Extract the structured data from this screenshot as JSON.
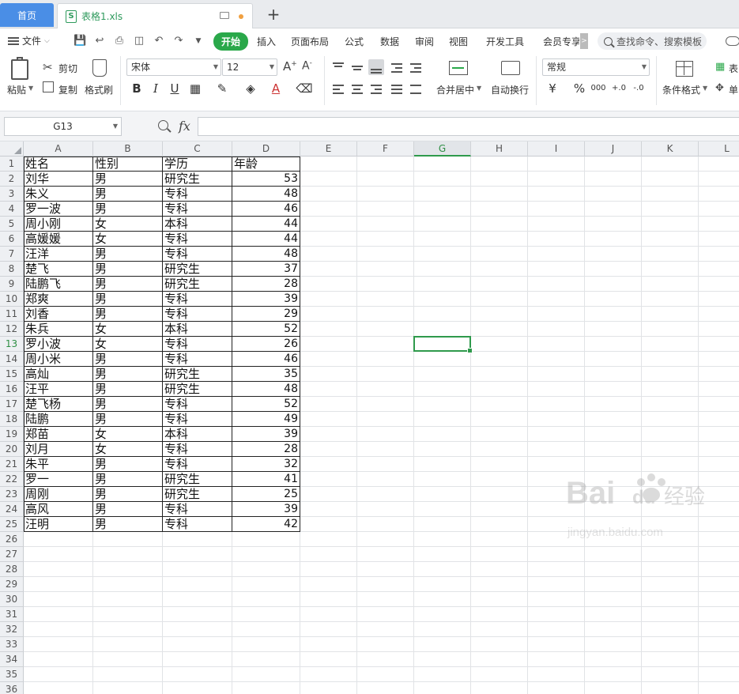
{
  "tabs": {
    "home": "首页",
    "file": "表格1.xls",
    "file_icon": "S",
    "new_tab": "+"
  },
  "menu": {
    "file": "文件",
    "tabs": [
      "开始",
      "插入",
      "页面布局",
      "公式",
      "数据",
      "审阅",
      "视图",
      "开发工具",
      "会员专享"
    ],
    "active_tab": "开始",
    "more": ">",
    "search_placeholder": "查找命令、搜索模板"
  },
  "ribbon": {
    "paste": "粘贴",
    "cut": "剪切",
    "copy": "复制",
    "format_painter": "格式刷",
    "font_name": "宋体",
    "font_size": "12",
    "bold": "B",
    "italic": "I",
    "underline": "U",
    "font_color_glyph": "A",
    "merge_center": "合并居中",
    "wrap_text": "自动换行",
    "number_format": "常规",
    "currency": "¥",
    "percent": "%",
    "thousands": "000",
    "dec_increase": "+.0",
    "dec_decrease": "-.0",
    "conditional_format": "条件格式",
    "table_style": "表",
    "cell_style": "单",
    "accent_color": "#2aa84a"
  },
  "formula_bar": {
    "name_box": "G13",
    "fx": "fx",
    "formula": ""
  },
  "sheet": {
    "columns": [
      "A",
      "B",
      "C",
      "D",
      "E",
      "F",
      "G",
      "H",
      "I",
      "J",
      "K",
      "L"
    ],
    "selected_column": "G",
    "selected_row": 13,
    "selected_cell": "G13",
    "row_numbers": [
      "1",
      "2",
      "3",
      "4",
      "5",
      "6",
      "7",
      "8",
      "9",
      "10",
      "11",
      "12",
      "13",
      "14",
      "15",
      "16",
      "17",
      "18",
      "19",
      "20",
      "21",
      "22",
      "23",
      "24",
      "25",
      "26",
      "27",
      "28",
      "29",
      "30",
      "31",
      "32",
      "33",
      "34",
      "35",
      "36"
    ],
    "headers": [
      "姓名",
      "性别",
      "学历",
      "年龄"
    ],
    "rows": [
      [
        "刘华",
        "男",
        "研究生",
        "53"
      ],
      [
        "朱义",
        "男",
        "专科",
        "48"
      ],
      [
        "罗一波",
        "男",
        "专科",
        "46"
      ],
      [
        "周小刚",
        "女",
        "本科",
        "44"
      ],
      [
        "高媛媛",
        "女",
        "专科",
        "44"
      ],
      [
        "汪洋",
        "男",
        "专科",
        "48"
      ],
      [
        "楚飞",
        "男",
        "研究生",
        "37"
      ],
      [
        "陆鹏飞",
        "男",
        "研究生",
        "28"
      ],
      [
        "郑爽",
        "男",
        "专科",
        "39"
      ],
      [
        "刘香",
        "男",
        "专科",
        "29"
      ],
      [
        "朱兵",
        "女",
        "本科",
        "52"
      ],
      [
        "罗小波",
        "女",
        "专科",
        "26"
      ],
      [
        "周小米",
        "男",
        "专科",
        "46"
      ],
      [
        "高灿",
        "男",
        "研究生",
        "35"
      ],
      [
        "汪平",
        "男",
        "研究生",
        "48"
      ],
      [
        "楚飞杨",
        "男",
        "专科",
        "52"
      ],
      [
        "陆鹏",
        "男",
        "专科",
        "49"
      ],
      [
        "郑苗",
        "女",
        "本科",
        "39"
      ],
      [
        "刘月",
        "女",
        "专科",
        "28"
      ],
      [
        "朱平",
        "男",
        "专科",
        "32"
      ],
      [
        "罗一",
        "男",
        "研究生",
        "41"
      ],
      [
        "周刚",
        "男",
        "研究生",
        "25"
      ],
      [
        "高风",
        "男",
        "专科",
        "39"
      ],
      [
        "汪明",
        "男",
        "专科",
        "42"
      ]
    ]
  },
  "watermark": {
    "brand": "Bai",
    "brand2": "du",
    "cn": "经验",
    "url": "jingyan.baidu.com"
  }
}
